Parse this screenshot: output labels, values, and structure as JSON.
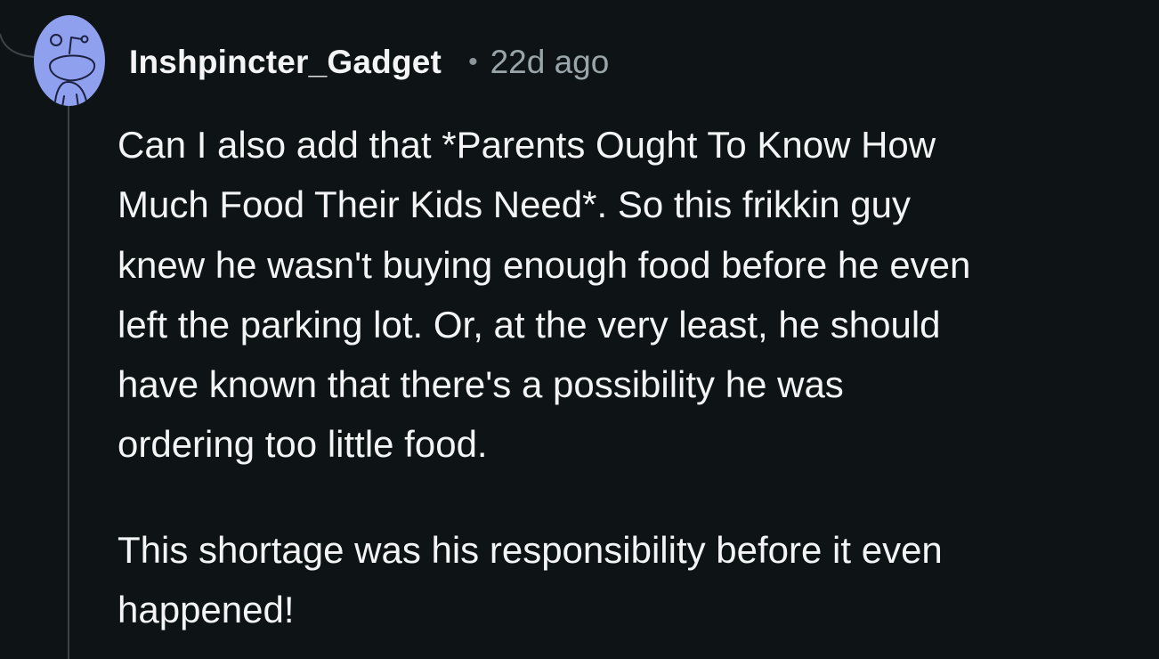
{
  "comment": {
    "author": "Inshpincter_Gadget",
    "separator": "•",
    "timestamp": "22d ago",
    "paragraphs": [
      {
        "lines": [
          "Can I also add that *Parents Ought To Know How",
          "Much Food Their Kids Need*. So this frikkin guy",
          "knew he wasn't buying enough food before he even",
          "left the parking lot. Or, at the very least, he should",
          "have known that there's a possibility he was",
          "ordering too little food."
        ]
      },
      {
        "lines": [
          "This shortage was his responsibility before it even",
          "happened!"
        ]
      }
    ]
  },
  "icons": {
    "avatar": "snoo-avatar-icon"
  },
  "colors": {
    "background": "#0e1415",
    "text": "#f2f4f5",
    "meta": "#9aa5a9",
    "avatar": "#8fa0ee",
    "thread_line": "#3c4447"
  }
}
